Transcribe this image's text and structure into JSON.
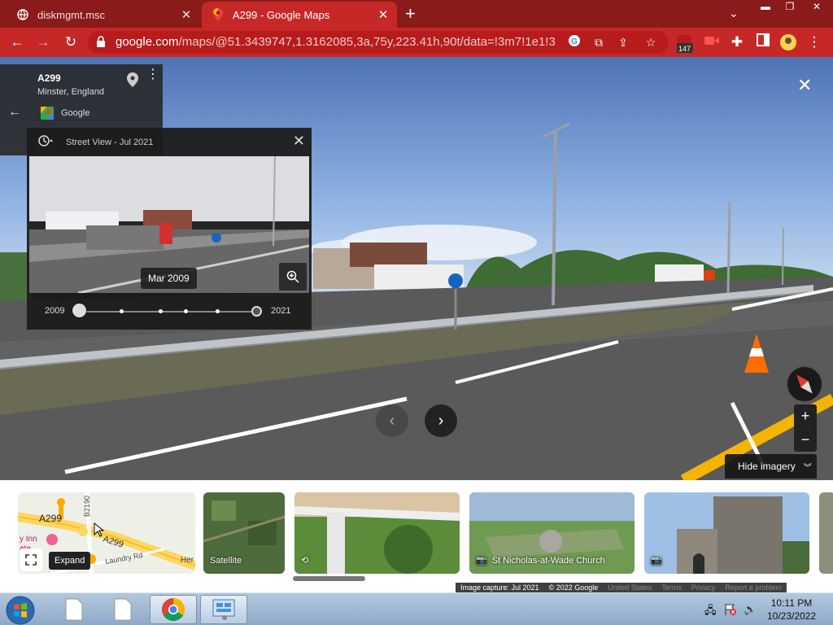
{
  "browser": {
    "tabs": [
      {
        "title": "diskmgmt.msc",
        "active": false
      },
      {
        "title": "A299 - Google Maps",
        "active": true
      }
    ],
    "url_main": "google.com",
    "url_rest": "/maps/@51.3439747,1.3162085,3a,75y,223.41h,90t/data=!3m7!1e1!3m5!1s...",
    "extension_badge": "147",
    "theme_color": "#c62828"
  },
  "place": {
    "name": "A299",
    "location": "Minster, England",
    "source": "Google"
  },
  "time_machine": {
    "header": "Street View - Jul 2021",
    "selected_date": "Mar 2009",
    "start_year": "2009",
    "end_year": "2021",
    "positions": [
      0,
      0.25,
      0.45,
      0.6,
      0.78,
      1
    ],
    "selected_index": 0
  },
  "controls": {
    "hide_imagery": "Hide imagery",
    "expand_tooltip": "Expand"
  },
  "map_thumb": {
    "labels": [
      "A299",
      "B2190",
      "A299",
      "Laundry Rd",
      "Her"
    ],
    "poi": "y Inn\nate"
  },
  "thumbnails": [
    {
      "label": "Satellite",
      "icon": ""
    },
    {
      "label": "",
      "icon": "360-icon"
    },
    {
      "label": "St Nicholas-at-Wade Church",
      "icon": "camera-icon"
    },
    {
      "label": "",
      "icon": "camera-icon"
    }
  ],
  "footer": {
    "capture": "Image capture: Jul 2021",
    "copyright": "© 2022 Google",
    "links": [
      "United States",
      "Terms",
      "Privacy",
      "Report a problem"
    ]
  },
  "taskbar": {
    "time": "10:11 PM",
    "date": "10/23/2022"
  }
}
